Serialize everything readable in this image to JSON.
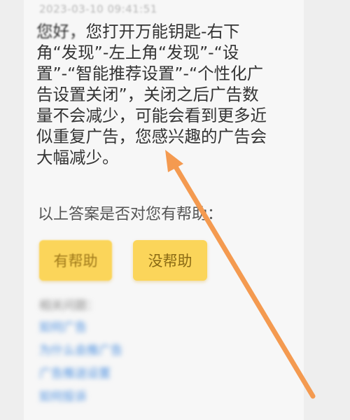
{
  "timestamp": "2023-03-10 09:41:51",
  "message": {
    "greeting": "您好，",
    "body": "您打开万能钥匙-右下角“发现”-左上角“发现”-“设置”-“智能推荐设置”-“个性化广告设置关闭”，关闭之后广告数量不会减少，可能会看到更多近似重复广告，您感兴趣的广告会大幅减少。"
  },
  "feedback": {
    "question": "以上答案是否对您有帮助：",
    "helpful_label": "有帮助",
    "unhelpful_label": "没帮助"
  },
  "related": {
    "title": "相关问题：",
    "links": [
      "如何广告",
      "为什么会推广告",
      "广告推送设置",
      "如何投诉"
    ]
  },
  "colors": {
    "button_bg": "#fbd55a",
    "arrow": "#f49a50",
    "link": "#4a8fe0"
  }
}
